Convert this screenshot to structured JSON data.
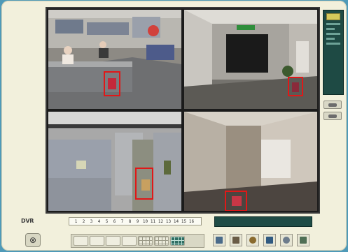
{
  "app": {
    "brand_label": "DVR"
  },
  "cameras": [
    {
      "id": "camera-1",
      "scene": "office reception",
      "detection": true
    },
    {
      "id": "camera-2",
      "scene": "lobby door",
      "detection": true
    },
    {
      "id": "camera-3",
      "scene": "cubicle aisle",
      "detection": true
    },
    {
      "id": "camera-4",
      "scene": "corridor",
      "detection": true
    }
  ],
  "channel_strip": {
    "channels": [
      "1",
      "2",
      "3",
      "4",
      "5",
      "6",
      "7",
      "8",
      "9",
      "10",
      "11",
      "12",
      "13",
      "14",
      "15",
      "16"
    ]
  },
  "status": {
    "text": ""
  },
  "controls": {
    "power_glyph": "⊗",
    "layouts": [
      "single",
      "quad",
      "six",
      "eight",
      "nine",
      "thirteen",
      "sixteen"
    ],
    "active_layout": "sixteen",
    "tools": [
      "record-icon",
      "playback-icon",
      "search-icon",
      "save-icon",
      "backup-icon",
      "network-icon"
    ]
  },
  "colors": {
    "detection_box": "#e01818",
    "panel_dark": "#1f4c46",
    "bezel": "#f2f0dc",
    "background": "#4f9ab8"
  }
}
